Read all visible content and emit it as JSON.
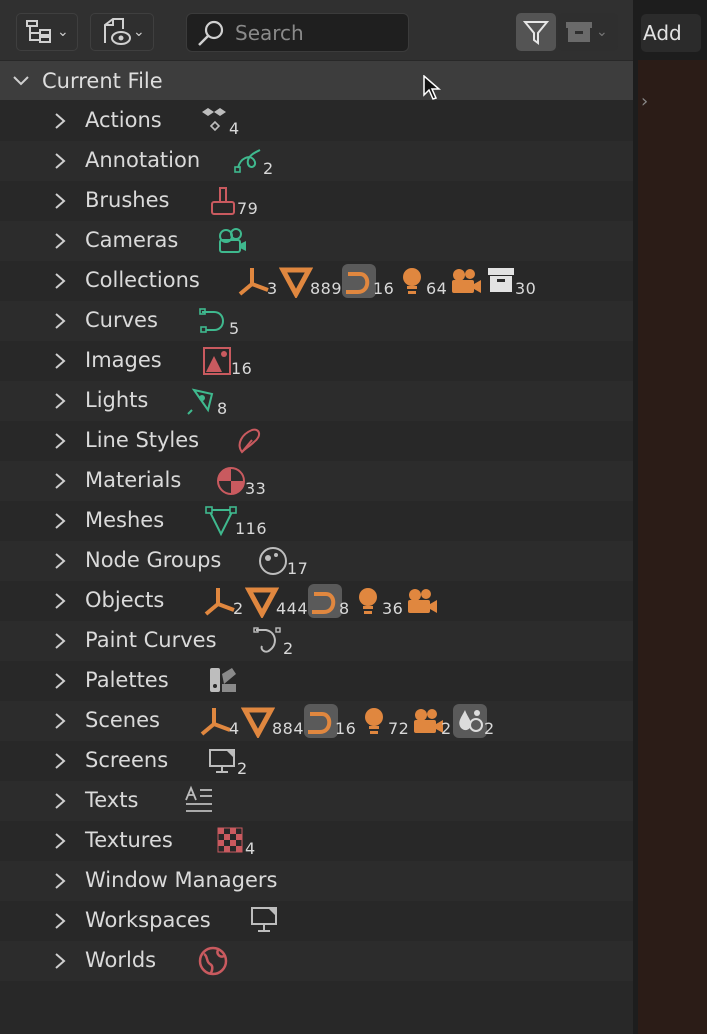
{
  "header": {
    "search_placeholder": "Search"
  },
  "side": {
    "add_label": "Add"
  },
  "tree": {
    "root_label": "Current File",
    "items": [
      {
        "label": "Actions",
        "badges": [
          {
            "icon": "action-icon",
            "count": "4"
          }
        ]
      },
      {
        "label": "Annotation",
        "badges": [
          {
            "icon": "annotation-icon",
            "count": "2"
          }
        ]
      },
      {
        "label": "Brushes",
        "badges": [
          {
            "icon": "brush-icon",
            "count": "79"
          }
        ]
      },
      {
        "label": "Cameras",
        "badges": [
          {
            "icon": "camera-data-icon",
            "count": ""
          }
        ]
      },
      {
        "label": "Collections",
        "badges": [
          {
            "icon": "empty-axes-icon",
            "count": "3"
          },
          {
            "icon": "mesh-icon",
            "count": "889"
          },
          {
            "icon": "curve-icon",
            "count": "16"
          },
          {
            "icon": "light-icon",
            "count": "64"
          },
          {
            "icon": "camera-object-icon",
            "count": ""
          },
          {
            "icon": "collection-box-icon",
            "count": "30"
          }
        ]
      },
      {
        "label": "Curves",
        "badges": [
          {
            "icon": "curve-data-icon",
            "count": "5"
          }
        ]
      },
      {
        "label": "Images",
        "badges": [
          {
            "icon": "image-icon",
            "count": "16"
          }
        ]
      },
      {
        "label": "Lights",
        "badges": [
          {
            "icon": "light-data-icon",
            "count": "8"
          }
        ]
      },
      {
        "label": "Line Styles",
        "badges": [
          {
            "icon": "line-style-icon",
            "count": ""
          }
        ]
      },
      {
        "label": "Materials",
        "badges": [
          {
            "icon": "material-icon",
            "count": "33"
          }
        ]
      },
      {
        "label": "Meshes",
        "badges": [
          {
            "icon": "mesh-data-icon",
            "count": "116"
          }
        ]
      },
      {
        "label": "Node Groups",
        "badges": [
          {
            "icon": "node-group-icon",
            "count": "17"
          }
        ]
      },
      {
        "label": "Objects",
        "badges": [
          {
            "icon": "empty-axes-icon",
            "count": "2"
          },
          {
            "icon": "mesh-icon",
            "count": "444"
          },
          {
            "icon": "curve-icon",
            "count": "8"
          },
          {
            "icon": "light-icon",
            "count": "36"
          },
          {
            "icon": "camera-object-icon",
            "count": ""
          }
        ]
      },
      {
        "label": "Paint Curves",
        "badges": [
          {
            "icon": "paint-curve-icon",
            "count": "2"
          }
        ]
      },
      {
        "label": "Palettes",
        "badges": [
          {
            "icon": "palette-icon",
            "count": ""
          }
        ]
      },
      {
        "label": "Scenes",
        "badges": [
          {
            "icon": "empty-axes-icon",
            "count": "4"
          },
          {
            "icon": "mesh-icon",
            "count": "884"
          },
          {
            "icon": "curve-icon",
            "count": "16"
          },
          {
            "icon": "light-icon",
            "count": "72"
          },
          {
            "icon": "camera-object-icon",
            "count": "2"
          },
          {
            "icon": "world-settings-icon",
            "count": "2"
          }
        ]
      },
      {
        "label": "Screens",
        "badges": [
          {
            "icon": "screen-icon",
            "count": "2"
          }
        ]
      },
      {
        "label": "Texts",
        "badges": [
          {
            "icon": "text-icon",
            "count": ""
          }
        ]
      },
      {
        "label": "Textures",
        "badges": [
          {
            "icon": "texture-icon",
            "count": "4"
          }
        ]
      },
      {
        "label": "Window Managers",
        "badges": []
      },
      {
        "label": "Workspaces",
        "badges": [
          {
            "icon": "workspace-icon",
            "count": ""
          }
        ]
      },
      {
        "label": "Worlds",
        "badges": [
          {
            "icon": "world-icon",
            "count": ""
          }
        ]
      }
    ]
  },
  "colors": {
    "orange": "#e0873f",
    "green": "#3fb98e",
    "red": "#c95a5f",
    "gray": "#bdbdbd"
  }
}
